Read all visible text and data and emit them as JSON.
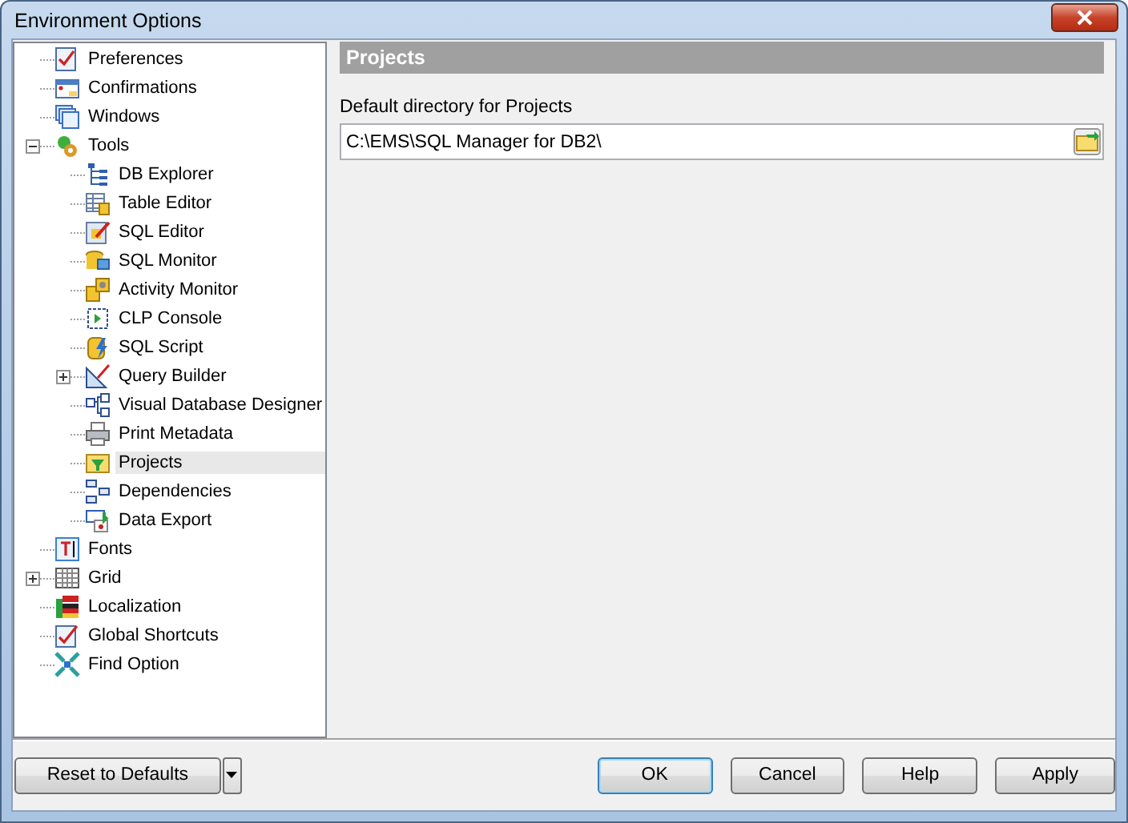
{
  "window": {
    "title": "Environment Options"
  },
  "tree": [
    {
      "label": "Preferences",
      "selected": false
    },
    {
      "label": "Confirmations",
      "selected": false
    },
    {
      "label": "Windows",
      "selected": false
    },
    {
      "label": "Tools",
      "selected": false,
      "expanded": true,
      "children": [
        {
          "label": "DB Explorer",
          "selected": false
        },
        {
          "label": "Table Editor",
          "selected": false
        },
        {
          "label": "SQL Editor",
          "selected": false
        },
        {
          "label": "SQL Monitor",
          "selected": false
        },
        {
          "label": "Activity Monitor",
          "selected": false
        },
        {
          "label": "CLP Console",
          "selected": false
        },
        {
          "label": "SQL Script",
          "selected": false
        },
        {
          "label": "Query Builder",
          "selected": false,
          "expanded": false
        },
        {
          "label": "Visual Database Designer",
          "selected": false
        },
        {
          "label": "Print Metadata",
          "selected": false
        },
        {
          "label": "Projects",
          "selected": true
        },
        {
          "label": "Dependencies",
          "selected": false
        },
        {
          "label": "Data Export",
          "selected": false
        }
      ]
    },
    {
      "label": "Fonts",
      "selected": false
    },
    {
      "label": "Grid",
      "selected": false,
      "expanded": false
    },
    {
      "label": "Localization",
      "selected": false
    },
    {
      "label": "Global Shortcuts",
      "selected": false
    },
    {
      "label": "Find Option",
      "selected": false
    }
  ],
  "panel": {
    "title": "Projects",
    "field_label": "Default directory for Projects",
    "field_value": "C:\\EMS\\SQL Manager for DB2\\"
  },
  "buttons": {
    "reset": "Reset to Defaults",
    "ok": "OK",
    "cancel": "Cancel",
    "help": "Help",
    "apply": "Apply"
  }
}
